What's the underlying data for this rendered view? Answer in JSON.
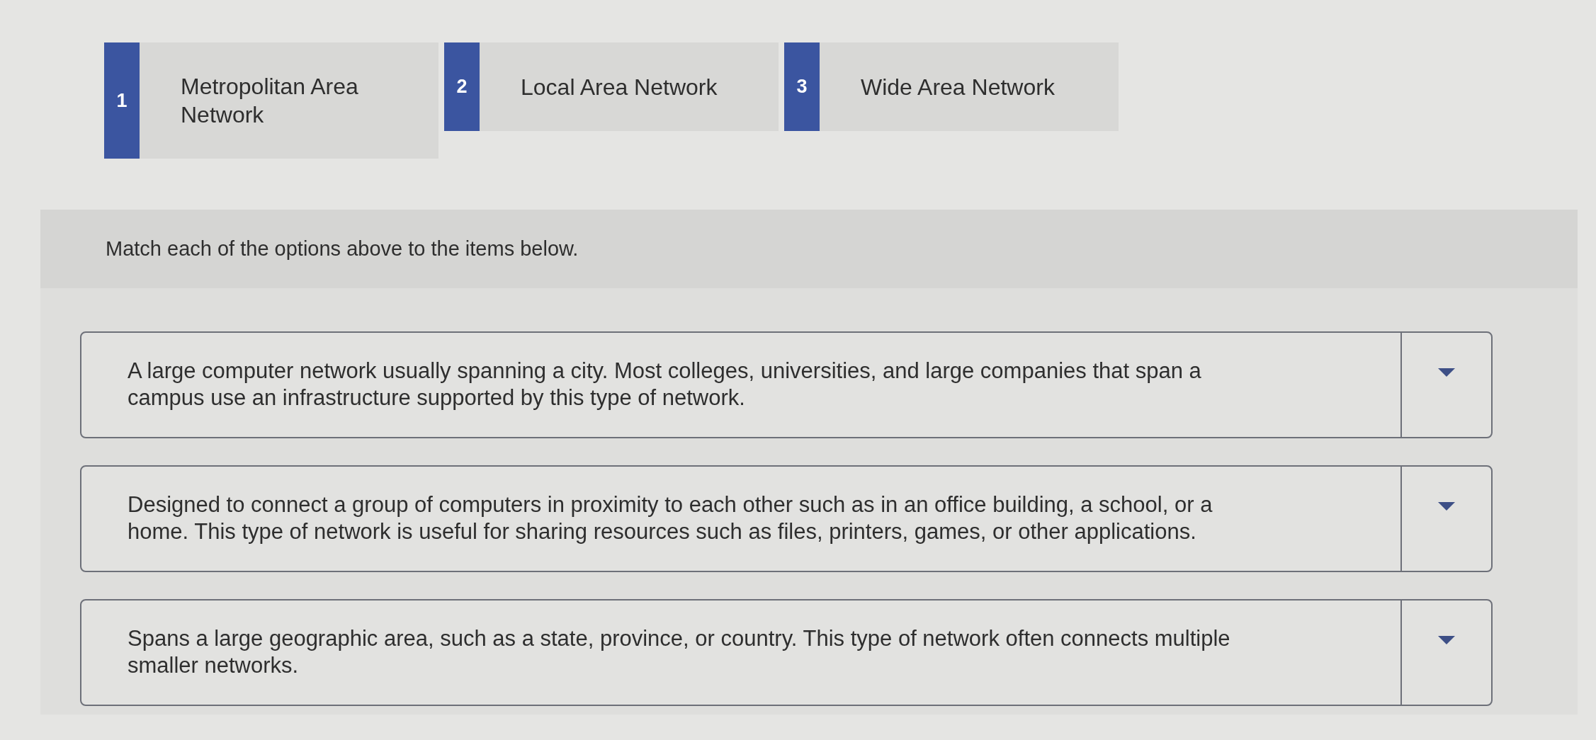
{
  "options": [
    {
      "number": "1",
      "label": "Metropolitan Area Network"
    },
    {
      "number": "2",
      "label": "Local Area Network"
    },
    {
      "number": "3",
      "label": "Wide Area Network"
    }
  ],
  "instruction": "Match each of the options above to the items below.",
  "items": [
    {
      "text": "A large computer network usually spanning a city. Most colleges, universities, and large companies that span a campus use an infrastructure supported by this type of network."
    },
    {
      "text": "Designed to connect a group of computers in proximity to each other such as in an office building, a school, or a home. This type of network is useful for sharing resources such as files, printers, games, or other applications."
    },
    {
      "text": "Spans a large geographic area, such as a state, province, or country. This type of network often connects multiple smaller networks."
    }
  ]
}
